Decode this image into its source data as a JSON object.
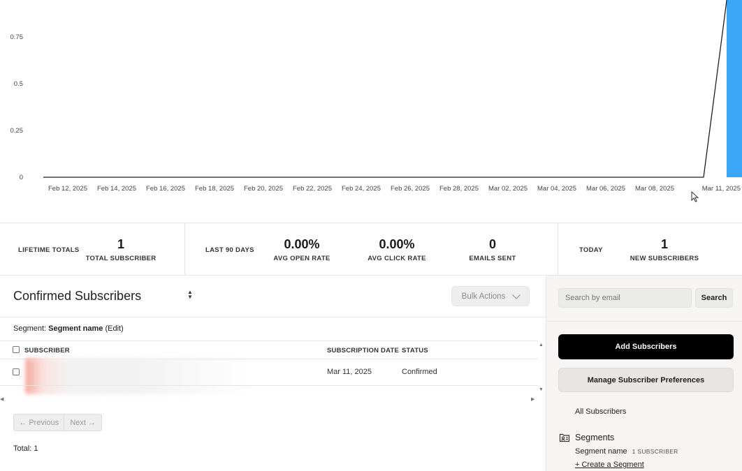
{
  "chart_data": {
    "type": "line",
    "title": "",
    "xlabel": "",
    "ylabel": "",
    "yticks": [
      "0",
      "0.25",
      "0.5",
      "0.75"
    ],
    "ylim": [
      0,
      1
    ],
    "xticks": [
      "Feb 12, 2025",
      "Feb 14, 2025",
      "Feb 16, 2025",
      "Feb 18, 2025",
      "Feb 20, 2025",
      "Feb 22, 2025",
      "Feb 24, 2025",
      "Feb 26, 2025",
      "Feb 28, 2025",
      "Mar 02, 2025",
      "Mar 04, 2025",
      "Mar 06, 2025",
      "Mar 08, 2025",
      "Mar 11, 2025"
    ],
    "series": [
      {
        "type": "line",
        "color": "#1f1f1f",
        "points": [
          [
            "Feb 11, 2025",
            0
          ],
          [
            "Mar 10, 2025",
            0
          ],
          [
            "Mar 11, 2025",
            1
          ]
        ]
      },
      {
        "type": "bar",
        "color": "#3ba6f5",
        "points": [
          [
            "Mar 11, 2025",
            1
          ]
        ]
      }
    ],
    "grid": false
  },
  "stats": {
    "lifetime_label": "LIFETIME TOTALS",
    "total_subscriber_value": "1",
    "total_subscriber_caption": "TOTAL SUBSCRIBER",
    "last90_label": "LAST 90 DAYS",
    "avg_open_value": "0.00%",
    "avg_open_caption": "AVG OPEN RATE",
    "avg_click_value": "0.00%",
    "avg_click_caption": "AVG CLICK RATE",
    "emails_sent_value": "0",
    "emails_sent_caption": "EMAILS SENT",
    "today_label": "TODAY",
    "new_subs_value": "1",
    "new_subs_caption": "NEW SUBSCRIBERS"
  },
  "list": {
    "title": "Confirmed Subscribers",
    "bulk_actions": "Bulk Actions",
    "segment_prefix": "Segment:",
    "segment_name": "Segment name",
    "segment_edit": "(Edit)",
    "columns": {
      "subscriber": "SUBSCRIBER",
      "subscription_date": "SUBSCRIPTION DATE",
      "status": "STATUS"
    },
    "rows": [
      {
        "subscription_date": "Mar 11, 2025",
        "status": "Confirmed"
      }
    ],
    "prev": "← Previous",
    "next": "Next →",
    "total": "Total: 1"
  },
  "sidebar": {
    "search_placeholder": "Search by email",
    "search_button": "Search",
    "add_button": "Add Subscribers",
    "prefs_button": "Manage Subscriber Preferences",
    "all_subscribers": "All Subscribers",
    "segments_heading": "Segments",
    "segment_item_name": "Segment name",
    "segment_item_count": "1 SUBSCRIBER",
    "create_segment": "+ Create a Segment"
  },
  "colors": {
    "bar": "#3ba6f5",
    "line": "#1f1f1f",
    "primary_button": "#000000"
  }
}
